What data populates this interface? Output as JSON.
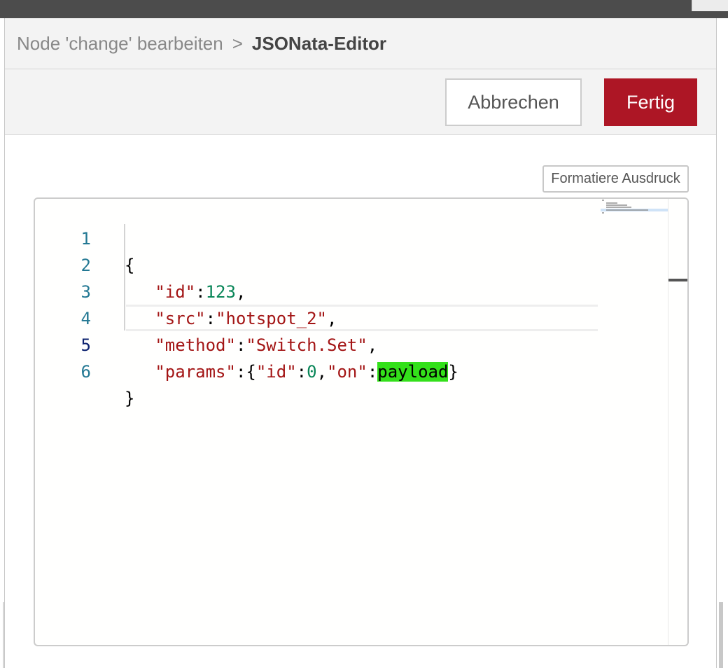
{
  "breadcrumb": {
    "parent": "Node 'change' bearbeiten",
    "separator": ">",
    "current": "JSONata-Editor"
  },
  "toolbar": {
    "cancel_label": "Abbrechen",
    "done_label": "Fertig"
  },
  "editor": {
    "format_button_label": "Formatiere Ausdruck",
    "active_line": 5,
    "lines": [
      {
        "number": "1",
        "tokens": [
          "{"
        ]
      },
      {
        "number": "2",
        "tokens": [
          "   ",
          "\"id\"",
          ":",
          "123",
          ","
        ]
      },
      {
        "number": "3",
        "tokens": [
          "   ",
          "\"src\"",
          ":",
          "\"hotspot_2\"",
          ","
        ]
      },
      {
        "number": "4",
        "tokens": [
          "   ",
          "\"method\"",
          ":",
          "\"Switch.Set\"",
          ","
        ]
      },
      {
        "number": "5",
        "tokens": [
          "   ",
          "\"params\"",
          ":{",
          "\"id\"",
          ":",
          "0",
          ",",
          "\"on\"",
          ":",
          "payload",
          "}"
        ]
      },
      {
        "number": "6",
        "tokens": [
          "}"
        ]
      }
    ],
    "highlight_match": "payload"
  },
  "colors": {
    "accent": "#ad1625",
    "string": "#a31515",
    "number": "#098658",
    "line_number": "#237893",
    "match_highlight": "#33e01a"
  }
}
